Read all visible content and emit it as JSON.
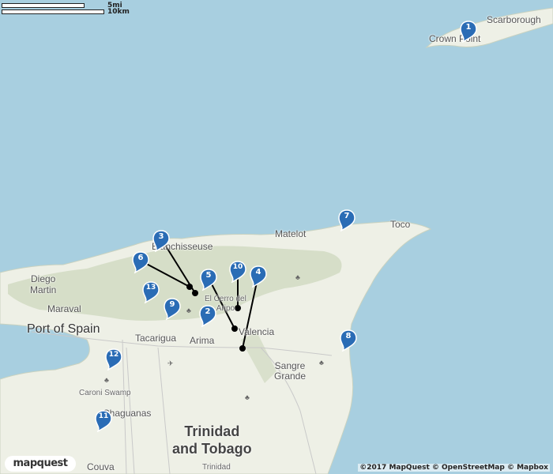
{
  "scale": {
    "miles": "5mi",
    "km": "10km"
  },
  "labels": {
    "scarborough": "Scarborough",
    "crown_point": "Crown Point",
    "toco": "Toco",
    "matelot": "Matelot",
    "blanchisseuse": "Blanchisseuse",
    "diego_martin": "Diego\nMartin",
    "maraval": "Maraval",
    "port_of_spain": "Port of Spain",
    "tacarigua": "Tacarigua",
    "arima": "Arima",
    "el_cerro": "El Cerro del\nAripo",
    "valencia": "Valencia",
    "sangre_grande": "Sangre\nGrande",
    "caroni_swamp": "Caroni Swamp",
    "chaguanas": "Chaguanas",
    "couva": "Couva",
    "trinidad_small": "Trinidad",
    "country": "Trinidad\nand Tobago"
  },
  "markers": [
    "1",
    "2",
    "3",
    "4",
    "5",
    "6",
    "7",
    "8",
    "9",
    "10",
    "11",
    "12",
    "13"
  ],
  "brand": {
    "logo": "mapquest",
    "attribution": "©2017 MapQuest © OpenStreetMap © Mapbox"
  },
  "colors": {
    "water": "#a8cfe0",
    "land": "#eef0e6",
    "forest": "#d3dcc4",
    "marker": "#2a6cb5",
    "route": "#000000"
  }
}
